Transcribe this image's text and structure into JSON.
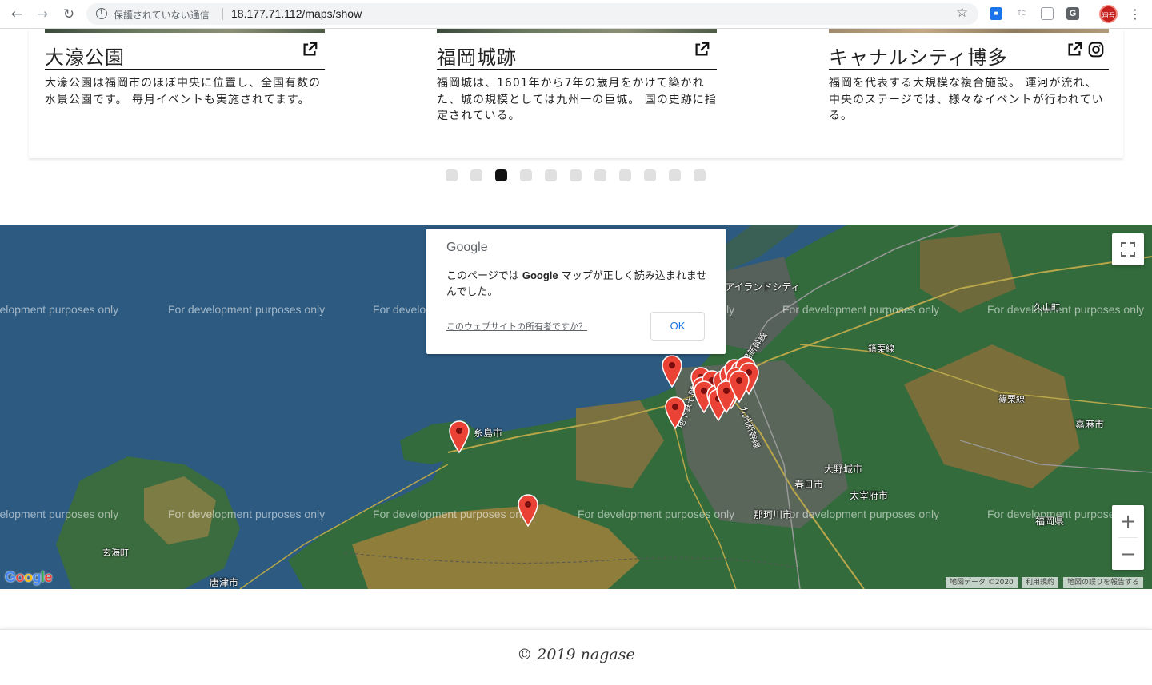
{
  "browser": {
    "security_text": "保護されていない通信",
    "url": "18.177.71.112/maps/show",
    "extensions": [
      "",
      "TC",
      "",
      "G"
    ],
    "avatar_text": "翔吾"
  },
  "carousel": {
    "cards": [
      {
        "title": "大濠公園",
        "description": "大濠公園は福岡市のほぼ中央に位置し、全国有数の水景公園です。 毎月イベントも実施されてます。",
        "has_instagram": false
      },
      {
        "title": "福岡城跡",
        "description": "福岡城は、1601年から7年の歳月をかけて築かれた、城の規模としては九州一の巨城。 国の史跡に指定されている。",
        "has_instagram": false
      },
      {
        "title": "キャナルシティ博多",
        "description": "福岡を代表する大規模な複合施設。 運河が流れ、中央のステージでは、様々なイベントが行われている。",
        "has_instagram": true
      }
    ],
    "dot_count": 11,
    "active_dot": 2
  },
  "map": {
    "dev_watermark": "For development purposes only",
    "places": [
      {
        "name": "糸島市"
      },
      {
        "name": "大野城市"
      },
      {
        "name": "春日市"
      },
      {
        "name": "太宰府市"
      },
      {
        "name": "那珂川市"
      },
      {
        "name": "嘉麻市"
      },
      {
        "name": "福岡県"
      },
      {
        "name": "玄海町"
      },
      {
        "name": "唐津市"
      },
      {
        "name": "篠栗線"
      },
      {
        "name": "篠栗線"
      },
      {
        "name": "久山町"
      },
      {
        "name": "地下鉄七隈線"
      },
      {
        "name": "九州新幹線"
      },
      {
        "name": "山陽新幹線"
      },
      {
        "name": "アイランドシティ"
      }
    ],
    "dialog": {
      "brand": "Google",
      "message_pre": "このページでは ",
      "message_bold": "Google",
      "message_post": " マップが正しく読み込まれませんでした。",
      "owner_link": "このウェブサイトの所有者ですか？",
      "ok_label": "OK"
    },
    "zoom_in_label": "+",
    "zoom_out_label": "−",
    "google_logo": "Google",
    "attribution": {
      "data": "地図データ ©2020",
      "terms": "利用規約",
      "report": "地図の誤りを報告する"
    },
    "marker_color": "#ea4335"
  },
  "footer": {
    "copyright": "© 2019 nagase"
  },
  "colors": {
    "sea": "#2c5a80",
    "land": "#2f6a3a",
    "mountain": "#8a7a3a"
  }
}
